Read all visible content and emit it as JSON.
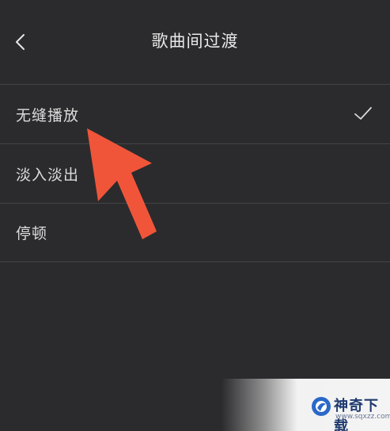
{
  "header": {
    "title": "歌曲间过渡",
    "back_icon": "chevron-left-icon"
  },
  "options": [
    {
      "label": "无缝播放",
      "selected": true
    },
    {
      "label": "淡入淡出",
      "selected": false
    },
    {
      "label": "停顿",
      "selected": false
    }
  ],
  "overlay": {
    "arrow_color": "#f0553a"
  },
  "watermark": {
    "brand": "神奇下载",
    "url": "www.sqxzz.com"
  },
  "colors": {
    "background": "#2b2b2d",
    "divider": "#444447",
    "text": "#dcdcdc"
  }
}
